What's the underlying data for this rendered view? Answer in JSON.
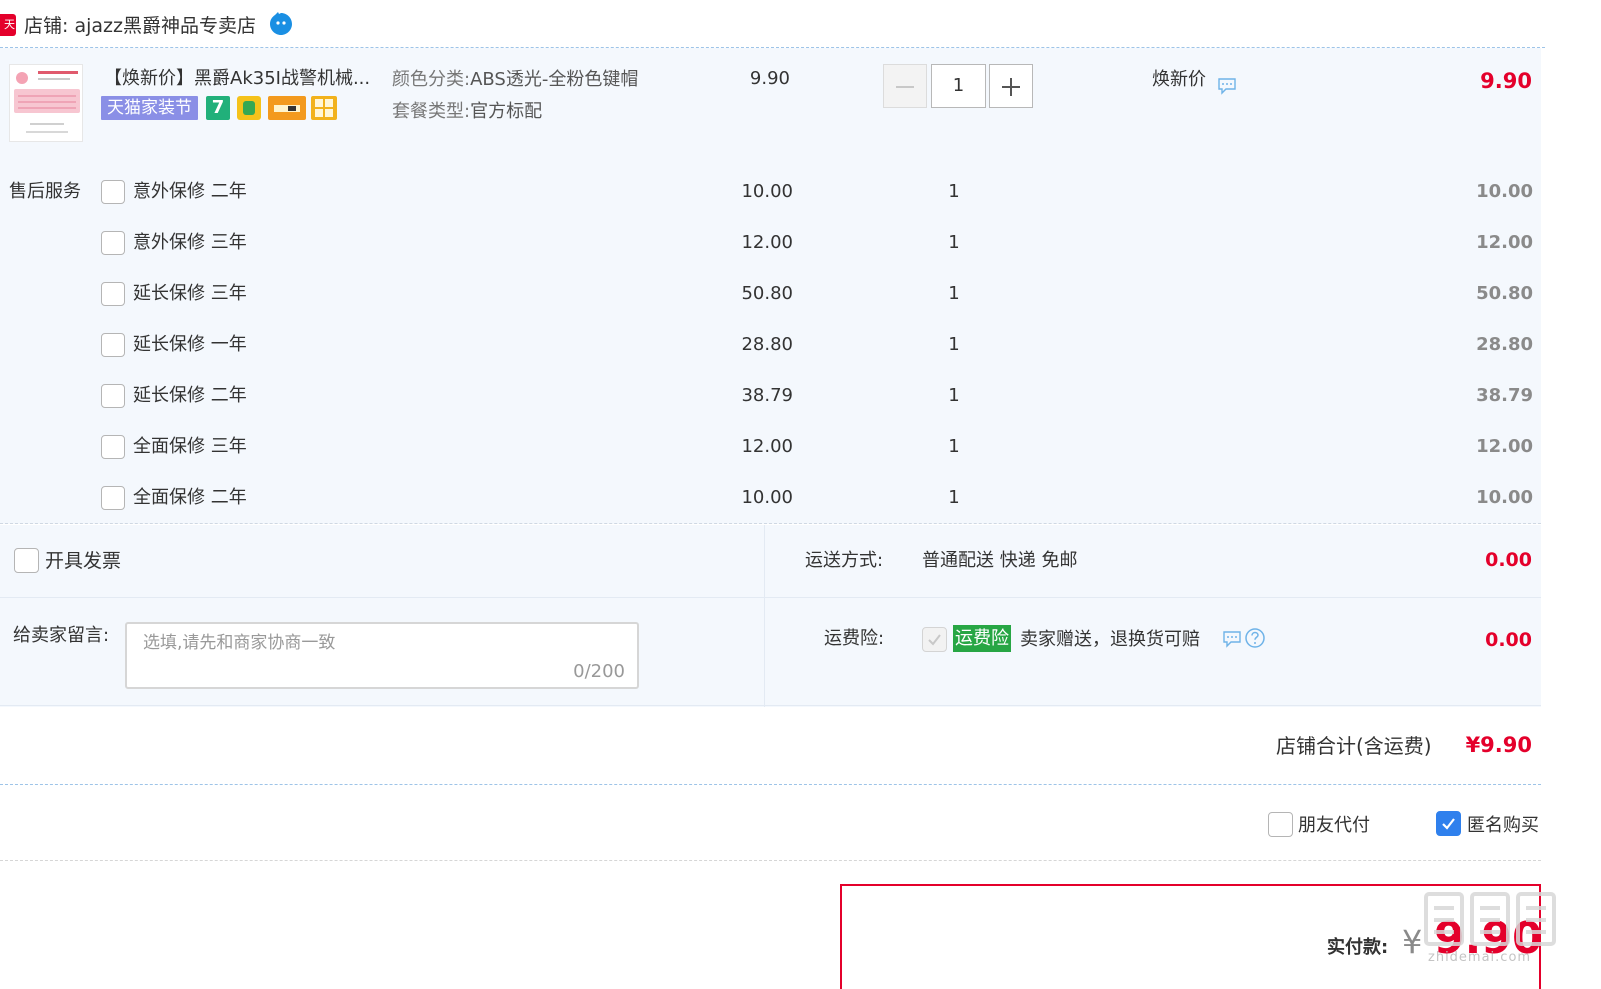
{
  "shop": {
    "badge": "天猫",
    "name": "店铺: ajazz黑爵神品专卖店"
  },
  "product": {
    "title": "【焕新价】黑爵Ak35I战警机械...",
    "tags": {
      "jzj": "天猫家装节",
      "seven": "7"
    },
    "spec_color_key": "颜色分类:",
    "spec_color_value": "ABS透光-全粉色键帽",
    "spec_pkg_key": "套餐类型:",
    "spec_pkg_value": "官方标配",
    "unit_price": "9.90",
    "quantity": "1",
    "promo_label": "焕新价",
    "line_total": "9.90"
  },
  "services": {
    "label": "售后服务",
    "items": [
      {
        "name": "意外保修 二年",
        "price": "10.00",
        "qty": "1",
        "total": "10.00"
      },
      {
        "name": "意外保修 三年",
        "price": "12.00",
        "qty": "1",
        "total": "12.00"
      },
      {
        "name": "延长保修 三年",
        "price": "50.80",
        "qty": "1",
        "total": "50.80"
      },
      {
        "name": "延长保修 一年",
        "price": "28.80",
        "qty": "1",
        "total": "28.80"
      },
      {
        "name": "延长保修 二年",
        "price": "38.79",
        "qty": "1",
        "total": "38.79"
      },
      {
        "name": "全面保修 三年",
        "price": "12.00",
        "qty": "1",
        "total": "12.00"
      },
      {
        "name": "全面保修 二年",
        "price": "10.00",
        "qty": "1",
        "total": "10.00"
      }
    ]
  },
  "options": {
    "invoice_label": "开具发票",
    "shipping_label": "运送方式:",
    "shipping_value": "普通配送 快递 免邮",
    "shipping_fee": "0.00",
    "message_label": "给卖家留言:",
    "message_placeholder": "选填,请先和商家协商一致",
    "message_value": "",
    "message_count": "0/200",
    "insurance_label": "运费险:",
    "insurance_tag": "运费险",
    "insurance_desc": "卖家赠送，退换货可赔",
    "insurance_fee": "0.00"
  },
  "summary": {
    "subtotal_label": "店铺合计(含运费)",
    "subtotal_value": "¥9.90",
    "friend_pay_label": "朋友代付",
    "anonymous_label": "匿名购买",
    "anonymous_checked": true,
    "pay_label": "实付款:",
    "pay_currency": "¥",
    "pay_amount": "9.90"
  },
  "watermark": {
    "text": "zhidemai.com"
  },
  "colors": {
    "accent_red": "#e4002b",
    "panel_bg": "#f4f8fd",
    "checkbox_blue": "#2f80ed",
    "insurance_green": "#27a644",
    "tag_purple": "#8a8fe6"
  }
}
